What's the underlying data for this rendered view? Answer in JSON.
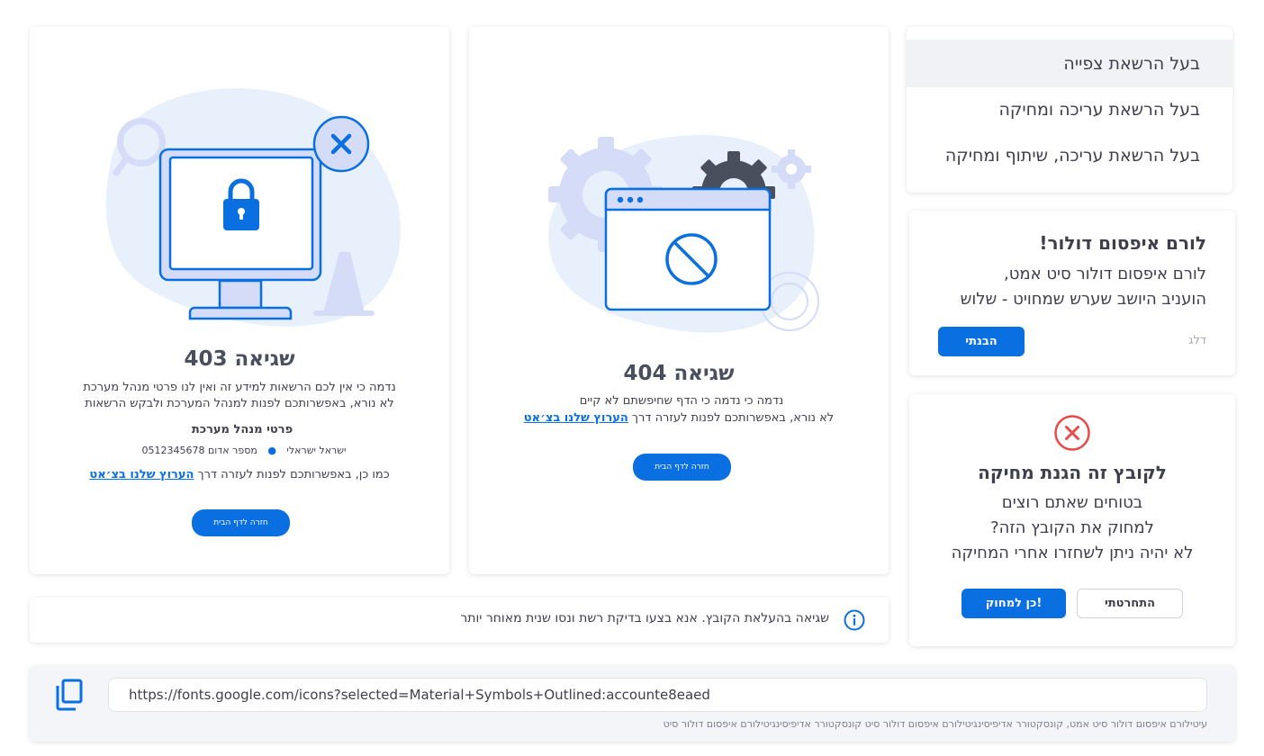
{
  "permissions_menu": {
    "items": [
      {
        "label": "בעל הרשאת צפייה"
      },
      {
        "label": "בעל הרשאת עריכה ומחיקה"
      },
      {
        "label": "בעל הרשאת עריכה, שיתוף ומחיקה"
      }
    ]
  },
  "info_dialog": {
    "title": "לורם איפסום דולור!",
    "line1": "לורם איפסום דולור סיט אמט,",
    "line2": "הועניב היושב שערש שמחויט - שלוש",
    "confirm_label": "הבנתי",
    "skip_label": "דלג"
  },
  "delete_dialog": {
    "title": "לקובץ זה הגנת מחיקה",
    "line1": "בטוחים שאתם רוצים",
    "line2": "למחוק את הקובץ הזה?",
    "line3": "לא יהיה ניתן לשחזרו אחרי המחיקה",
    "confirm_label": "כן למחוק!",
    "cancel_label": "התחרטתי"
  },
  "error_404": {
    "title": "שגיאה 404",
    "line1": "נדמה כי נדמה כי הדף שחיפשתם לא קיים",
    "line2_prefix": "לא נורא, באפשרותכם לפנות לעזרה דרך",
    "chat_link": "הערוץ שלנו בצ׳אט",
    "home_button": "חזרה לדף הבית"
  },
  "error_403": {
    "title": "שגיאה 403",
    "line1": "נדמה כי אין לכם הרשאות למידע זה ואין לנו פרטי מנהל מערכת",
    "line2": "לא נורא, באפשרותכם לפנות למנהל המערכת ולבקש הרשאות",
    "admin_heading": "פרטי מנהל מערכת",
    "admin_name": "ישראל ישראלי",
    "admin_phone": "מספר אדום 0512345678",
    "line3_prefix": "כמו כן, באפשרותכם לפנות לעזרה דרך",
    "chat_link": "הערוץ שלנו בצ׳אט",
    "home_button": "חזרה לדף הבית"
  },
  "upload_error": {
    "message": "שגיאה בהעלאת הקובץ. אנא בצעו בדיקת רשת ונסו שנית מאוחר יותר"
  },
  "link_bar": {
    "url_value": "https://fonts.google.com/icons?selected=Material+Symbols+Outlined:accounte8eaed",
    "caption": "עיטילורם איפסום דולור סיט אמט, קונסקטורר אדיפיסינגיטילורם איפסום דולור סיט קונסקטורר אדיפיסינגיטילורם איפסום דולור סיט"
  },
  "colors": {
    "accent": "#0a6fe0",
    "error": "#e84a4a",
    "illustration_light": "#e8f0fb",
    "illustration_mid": "#d4dcf7",
    "gear_dark": "#4a4f5e"
  }
}
